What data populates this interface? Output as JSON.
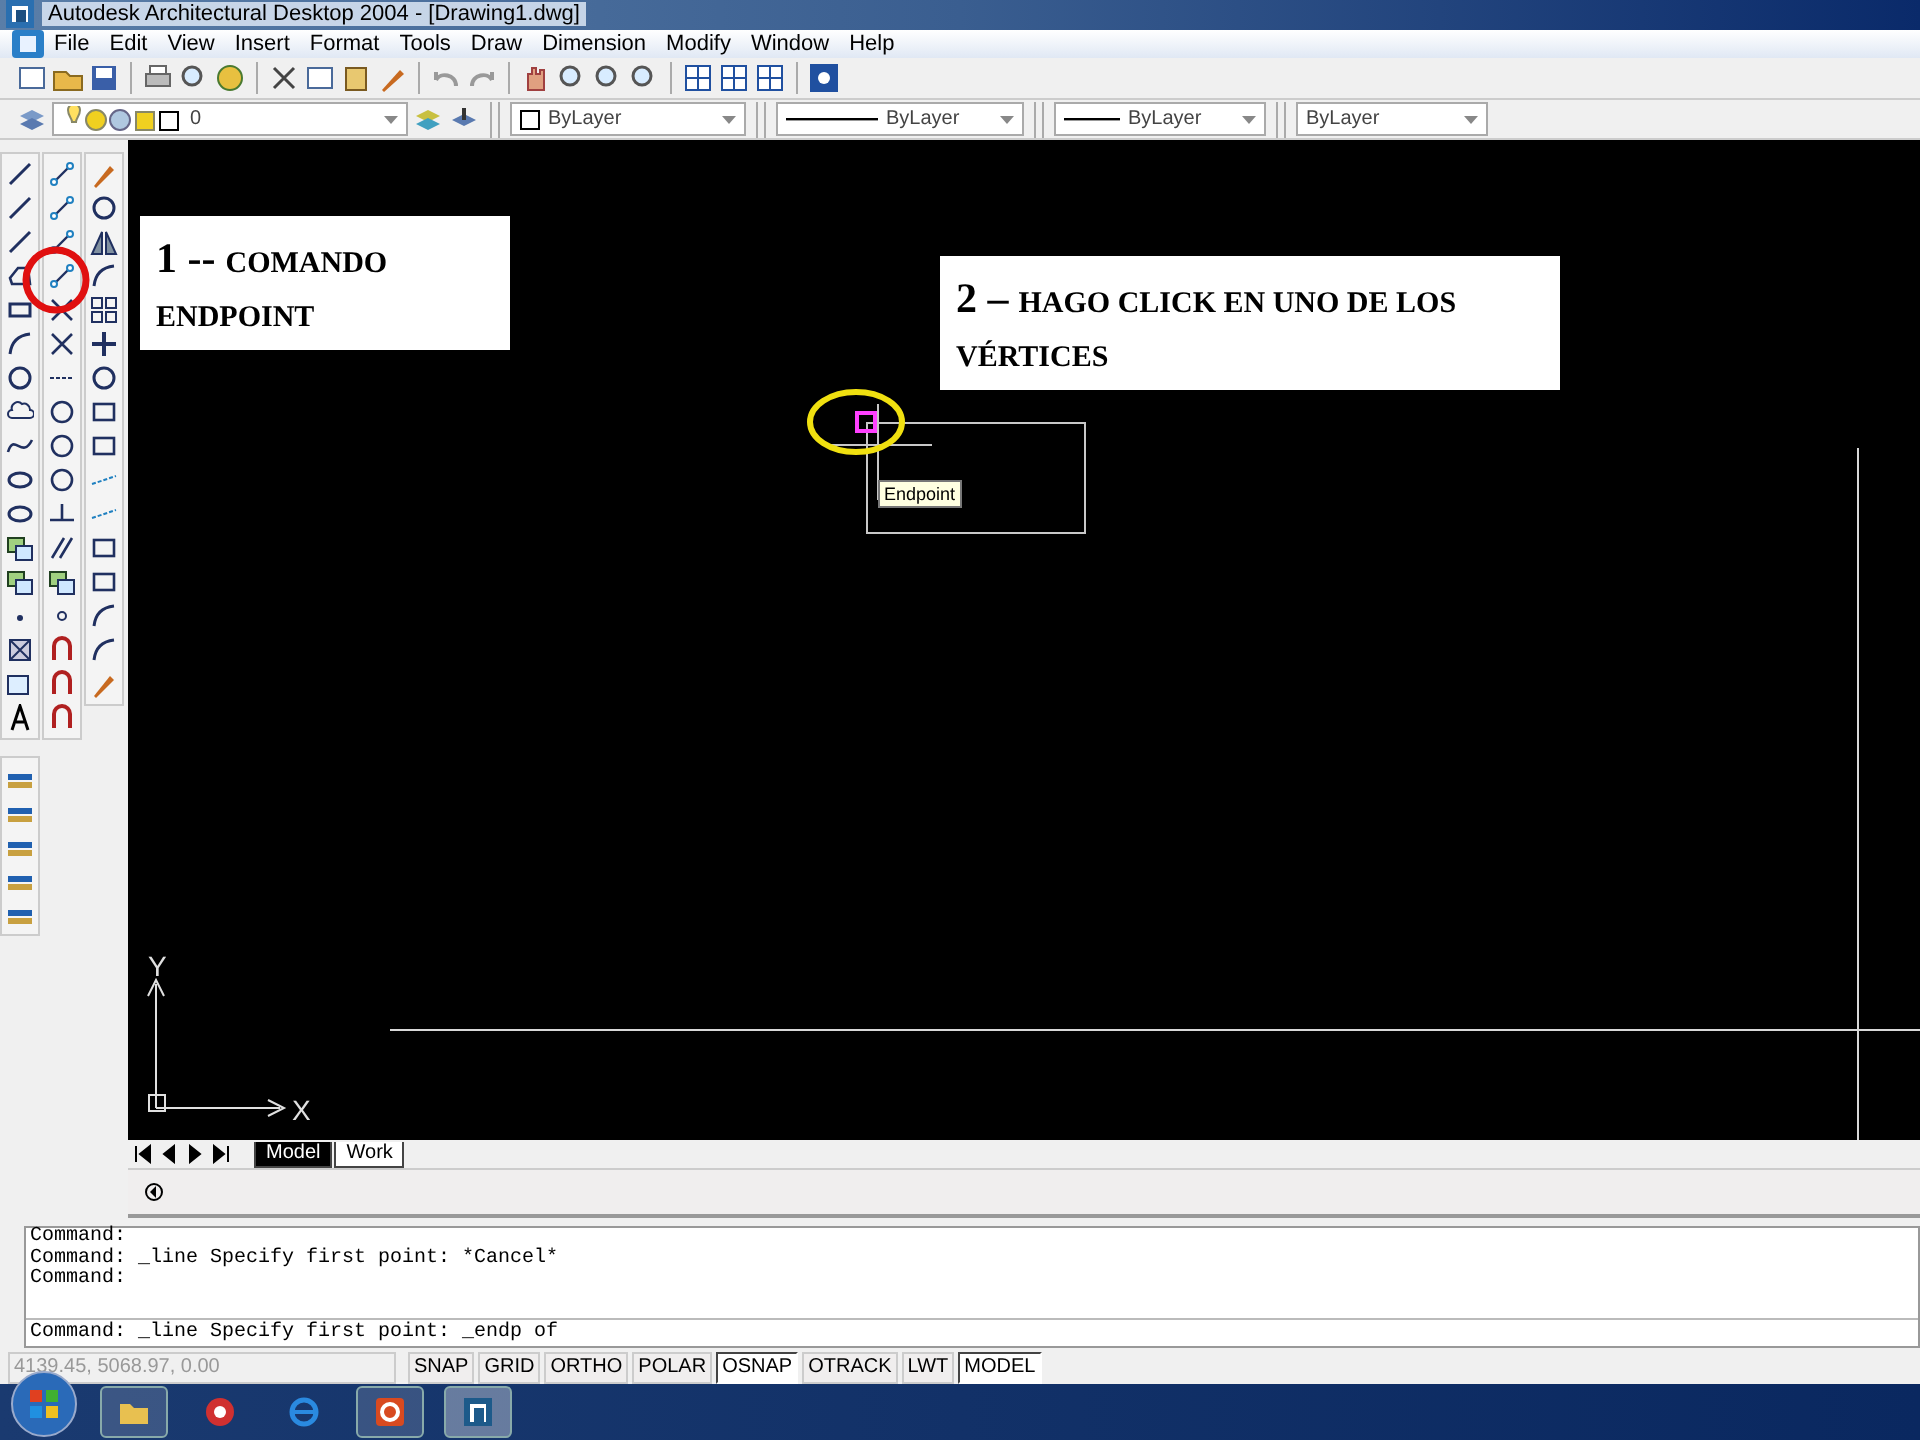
{
  "window": {
    "title": "Autodesk Architectural Desktop 2004 - [Drawing1.dwg]"
  },
  "menu": [
    "File",
    "Edit",
    "View",
    "Insert",
    "Format",
    "Tools",
    "Draw",
    "Dimension",
    "Modify",
    "Window",
    "Help"
  ],
  "properties_toolbar": {
    "layer": "0",
    "color_setting": "ByLayer",
    "linetype": "ByLayer",
    "lineweight": "ByLayer",
    "plot_style": "ByLayer"
  },
  "annotations": [
    {
      "number": "1 --",
      "text": "COMANDO ENDPOINT"
    },
    {
      "number": "2 –",
      "text": "HAGO CLICK EN UNO DE LOS VÉRTICES"
    }
  ],
  "tooltip": "Endpoint",
  "ucs": {
    "y": "Y",
    "x": "X"
  },
  "layout_tabs": [
    {
      "label": "Model",
      "selected": true
    },
    {
      "label": "Work",
      "selected": false
    }
  ],
  "command_history": [
    "Command:",
    "Command: _line Specify first point: *Cancel*",
    "Command:"
  ],
  "command_prompt": "Command: _line Specify first point: _endp of",
  "coordinates": "4139.45, 5068.97, 0.00",
  "status_buttons": [
    {
      "label": "SNAP",
      "on": false
    },
    {
      "label": "GRID",
      "on": false
    },
    {
      "label": "ORTHO",
      "on": false
    },
    {
      "label": "POLAR",
      "on": false
    },
    {
      "label": "OSNAP",
      "on": true
    },
    {
      "label": "OTRACK",
      "on": false
    },
    {
      "label": "LWT",
      "on": false
    },
    {
      "label": "MODEL",
      "on": true
    }
  ]
}
